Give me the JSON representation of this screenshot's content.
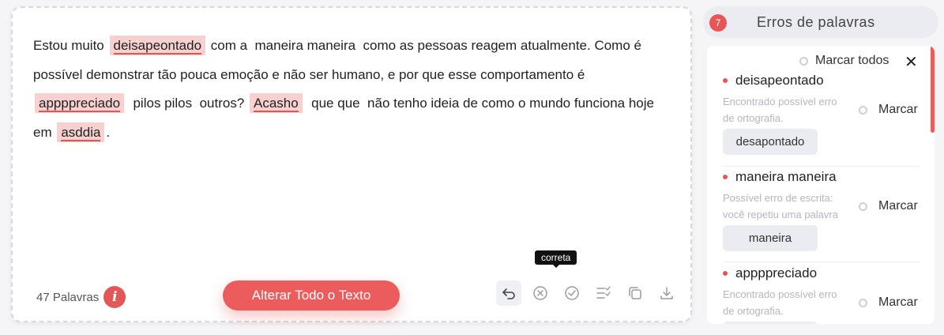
{
  "editor": {
    "segments": [
      {
        "text": "Estou muito ",
        "error": false
      },
      {
        "text": "deisapeontado",
        "error": true
      },
      {
        "text": " com a  maneira maneira  como as pessoas reagem atualmente. Como é possível demonstrar tão pouca emoção e não ser humano, e por que esse comportamento é ",
        "error": false
      },
      {
        "text": "appppreciado",
        "error": true
      },
      {
        "text": "  pilos pilos  outros? ",
        "error": false
      },
      {
        "text": "Acasho",
        "error": true
      },
      {
        "text": "  que que  não tenho ideia de como o mundo funciona hoje em ",
        "error": false
      },
      {
        "text": "asddia",
        "error": true
      },
      {
        "text": ".",
        "error": false
      }
    ],
    "word_count": "47 Palavras",
    "info_icon": "i",
    "primary_button": "Alterar Todo o Texto",
    "tooltip": "correta",
    "tools": [
      "undo-icon",
      "ignore-icon",
      "accept-icon",
      "list-check-icon",
      "copy-icon",
      "download-icon"
    ]
  },
  "panel": {
    "count": "7",
    "title": "Erros de palavras",
    "mark_all": "Marcar todos",
    "close": "✕",
    "items": [
      {
        "word": "deisapeontado",
        "desc": "Encontrado possível erro de ortografia.",
        "mark": "Marcar",
        "suggestion": "desapontado"
      },
      {
        "word": "maneira maneira",
        "desc": "Possível erro de escrita: você repetiu uma palavra",
        "mark": "Marcar",
        "suggestion": "maneira"
      },
      {
        "word": "appppreciado",
        "desc": "Encontrado possível erro de ortografia.",
        "mark": "Marcar",
        "suggestion": ""
      }
    ]
  },
  "colors": {
    "accent": "#ec5c5c",
    "highlight": "#f7d0d0",
    "underline": "#e25555"
  }
}
